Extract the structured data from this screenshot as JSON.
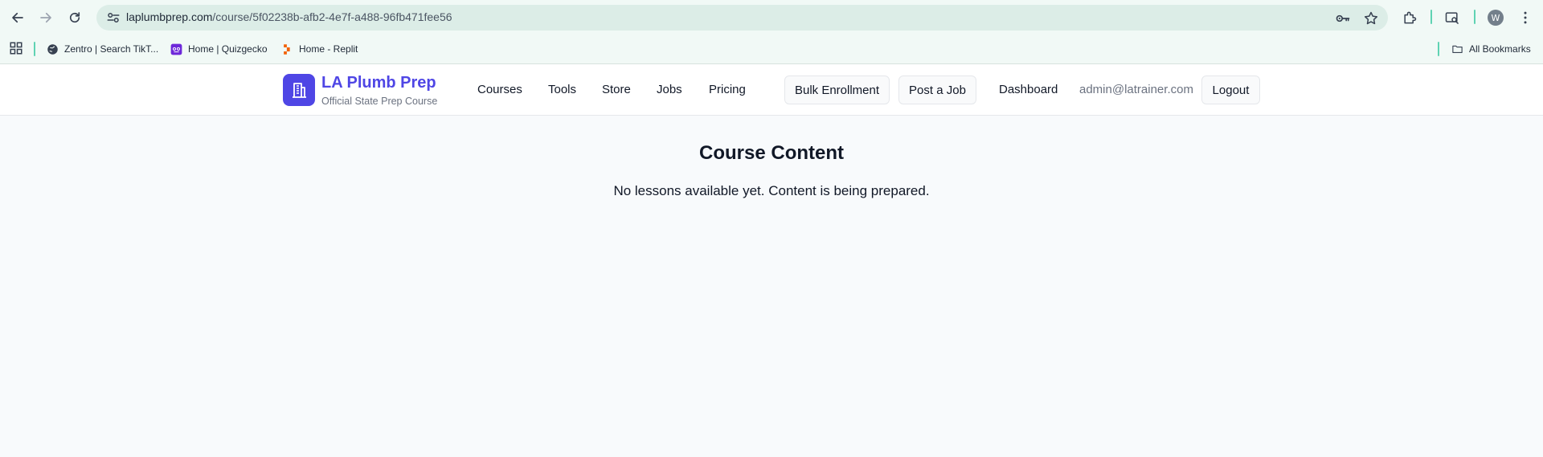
{
  "browser": {
    "url_domain": "laplumbprep.com",
    "url_path": "/course/5f02238b-afb2-4e7f-a488-96fb471fee56",
    "profile_initial": "W",
    "bookmarks": [
      {
        "label": "Zentro | Search TikT...",
        "icon": "globe-icon"
      },
      {
        "label": "Home | Quizgecko",
        "icon": "quizgecko-icon"
      },
      {
        "label": "Home - Replit",
        "icon": "replit-icon"
      }
    ],
    "all_bookmarks_label": "All Bookmarks",
    "accent_color": "#5fd3b3"
  },
  "site": {
    "brand_title": "LA Plumb Prep",
    "brand_subtitle": "Official State Prep Course",
    "brand_color": "#4f46e5",
    "nav": [
      "Courses",
      "Tools",
      "Store",
      "Jobs",
      "Pricing"
    ],
    "bulk_enrollment_label": "Bulk Enrollment",
    "post_job_label": "Post a Job",
    "dashboard_label": "Dashboard",
    "user_email": "admin@latrainer.com",
    "logout_label": "Logout"
  },
  "main": {
    "title": "Course Content",
    "message": "No lessons available yet. Content is being prepared."
  }
}
